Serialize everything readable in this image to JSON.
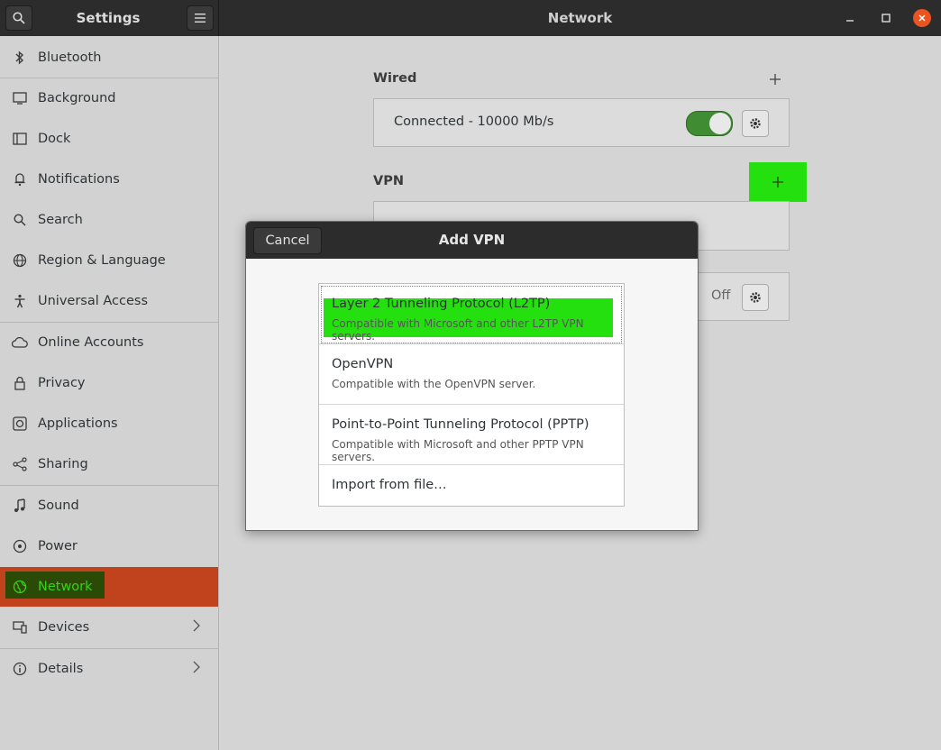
{
  "header": {
    "sidebar_title": "Settings",
    "main_title": "Network",
    "search_icon": "search-icon",
    "menu_icon": "hamburger-menu-icon"
  },
  "sidebar": {
    "items": [
      {
        "label": "Bluetooth",
        "icon": "bluetooth-icon"
      },
      {
        "label": "Background",
        "icon": "background-icon"
      },
      {
        "label": "Dock",
        "icon": "dock-icon"
      },
      {
        "label": "Notifications",
        "icon": "bell-icon"
      },
      {
        "label": "Search",
        "icon": "search-icon"
      },
      {
        "label": "Region & Language",
        "icon": "globe-icon"
      },
      {
        "label": "Universal Access",
        "icon": "accessibility-icon"
      },
      {
        "label": "Online Accounts",
        "icon": "cloud-icon"
      },
      {
        "label": "Privacy",
        "icon": "lock-icon"
      },
      {
        "label": "Applications",
        "icon": "applications-icon"
      },
      {
        "label": "Sharing",
        "icon": "share-icon"
      },
      {
        "label": "Sound",
        "icon": "music-note-icon"
      },
      {
        "label": "Power",
        "icon": "power-icon"
      },
      {
        "label": "Network",
        "icon": "network-icon"
      },
      {
        "label": "Devices",
        "icon": "devices-icon"
      },
      {
        "label": "Details",
        "icon": "info-icon"
      }
    ],
    "selected": "Network"
  },
  "main": {
    "wired": {
      "title": "Wired",
      "status": "Connected - 10000 Mb/s",
      "enabled": true
    },
    "vpn": {
      "title": "VPN"
    },
    "proxy": {
      "status": "Off"
    }
  },
  "dialog": {
    "title": "Add VPN",
    "cancel_label": "Cancel",
    "options": [
      {
        "title": "Layer 2 Tunneling Protocol (L2TP)",
        "subtitle": "Compatible with Microsoft and other L2TP VPN servers."
      },
      {
        "title": "OpenVPN",
        "subtitle": "Compatible with the OpenVPN server."
      },
      {
        "title": "Point-to-Point Tunneling Protocol (PPTP)",
        "subtitle": "Compatible with Microsoft and other PPTP VPN servers."
      },
      {
        "title": "Import from file…",
        "subtitle": ""
      }
    ],
    "selected_index": 0
  },
  "colors": {
    "accent": "#e95420",
    "selection": "#c1431e",
    "highlight": "#25e00f",
    "switch_on": "#3f8c32"
  }
}
